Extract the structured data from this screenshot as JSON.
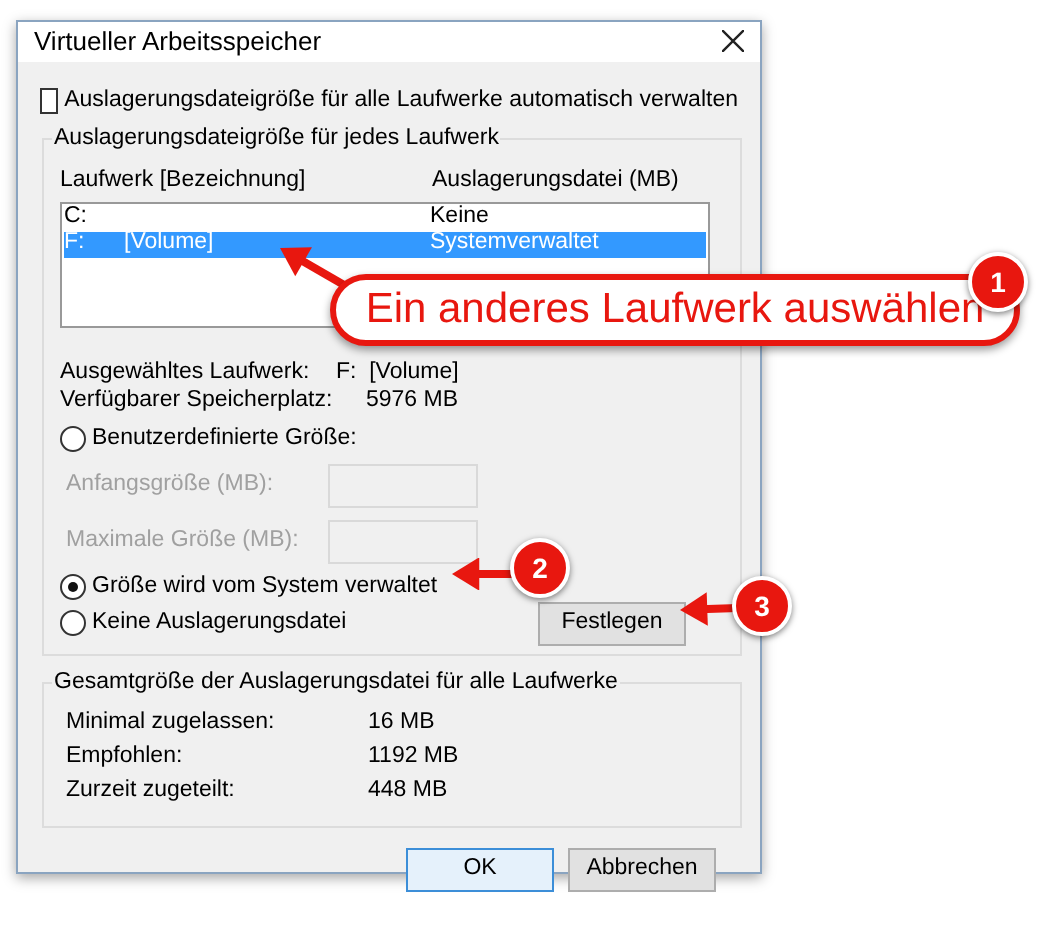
{
  "window": {
    "title": "Virtueller Arbeitsspeicher"
  },
  "auto_manage": {
    "label": "Auslagerungsdateigröße für alle Laufwerke automatisch verwalten",
    "checked": false
  },
  "per_drive": {
    "title": "Auslagerungsdateigröße für jedes Laufwerk",
    "columns": [
      "Laufwerk [Bezeichnung]",
      "Auslagerungsdatei (MB)"
    ],
    "drives": [
      {
        "drive": "C:",
        "paging_file": "Keine",
        "selected": false
      },
      {
        "drive": "F:",
        "label": "[Volume]",
        "paging_file": "Systemverwaltet",
        "selected": true
      }
    ],
    "info": [
      {
        "label": "Ausgewähltes Laufwerk:",
        "value": "F:  [Volume]"
      },
      {
        "label": "Verfügbarer Speicherplatz:",
        "value": "5976 MB"
      }
    ],
    "options": [
      {
        "kind": "radio",
        "label": "Benutzerdefinierte Größe:",
        "selected": false
      },
      {
        "kind": "field",
        "label": "Anfangsgröße (MB):",
        "disabled": true
      },
      {
        "kind": "field",
        "label": "Maximale Größe (MB):",
        "disabled": true
      },
      {
        "kind": "radio",
        "label": "Größe wird vom System verwaltet",
        "selected": true
      },
      {
        "kind": "radio",
        "label": "Keine Auslagerungsdatei",
        "selected": false
      }
    ],
    "set_button": {
      "label": "Festlegen"
    }
  },
  "totals": {
    "title": "Gesamtgröße der Auslagerungsdatei für alle Laufwerke",
    "rows": [
      {
        "label": "Minimal zugelassen:",
        "value": "16 MB"
      },
      {
        "label": "Empfohlen:",
        "value": "1192 MB"
      },
      {
        "label": "Zurzeit zugeteilt:",
        "value": "448 MB"
      }
    ]
  },
  "buttons": [
    {
      "label": "OK",
      "default": true
    },
    {
      "label": "Abbrechen",
      "default": false
    }
  ],
  "annotations": [
    {
      "number": "1",
      "text": "Ein anderes Laufwerk auswählen"
    },
    {
      "number": "2"
    },
    {
      "number": "3"
    }
  ]
}
